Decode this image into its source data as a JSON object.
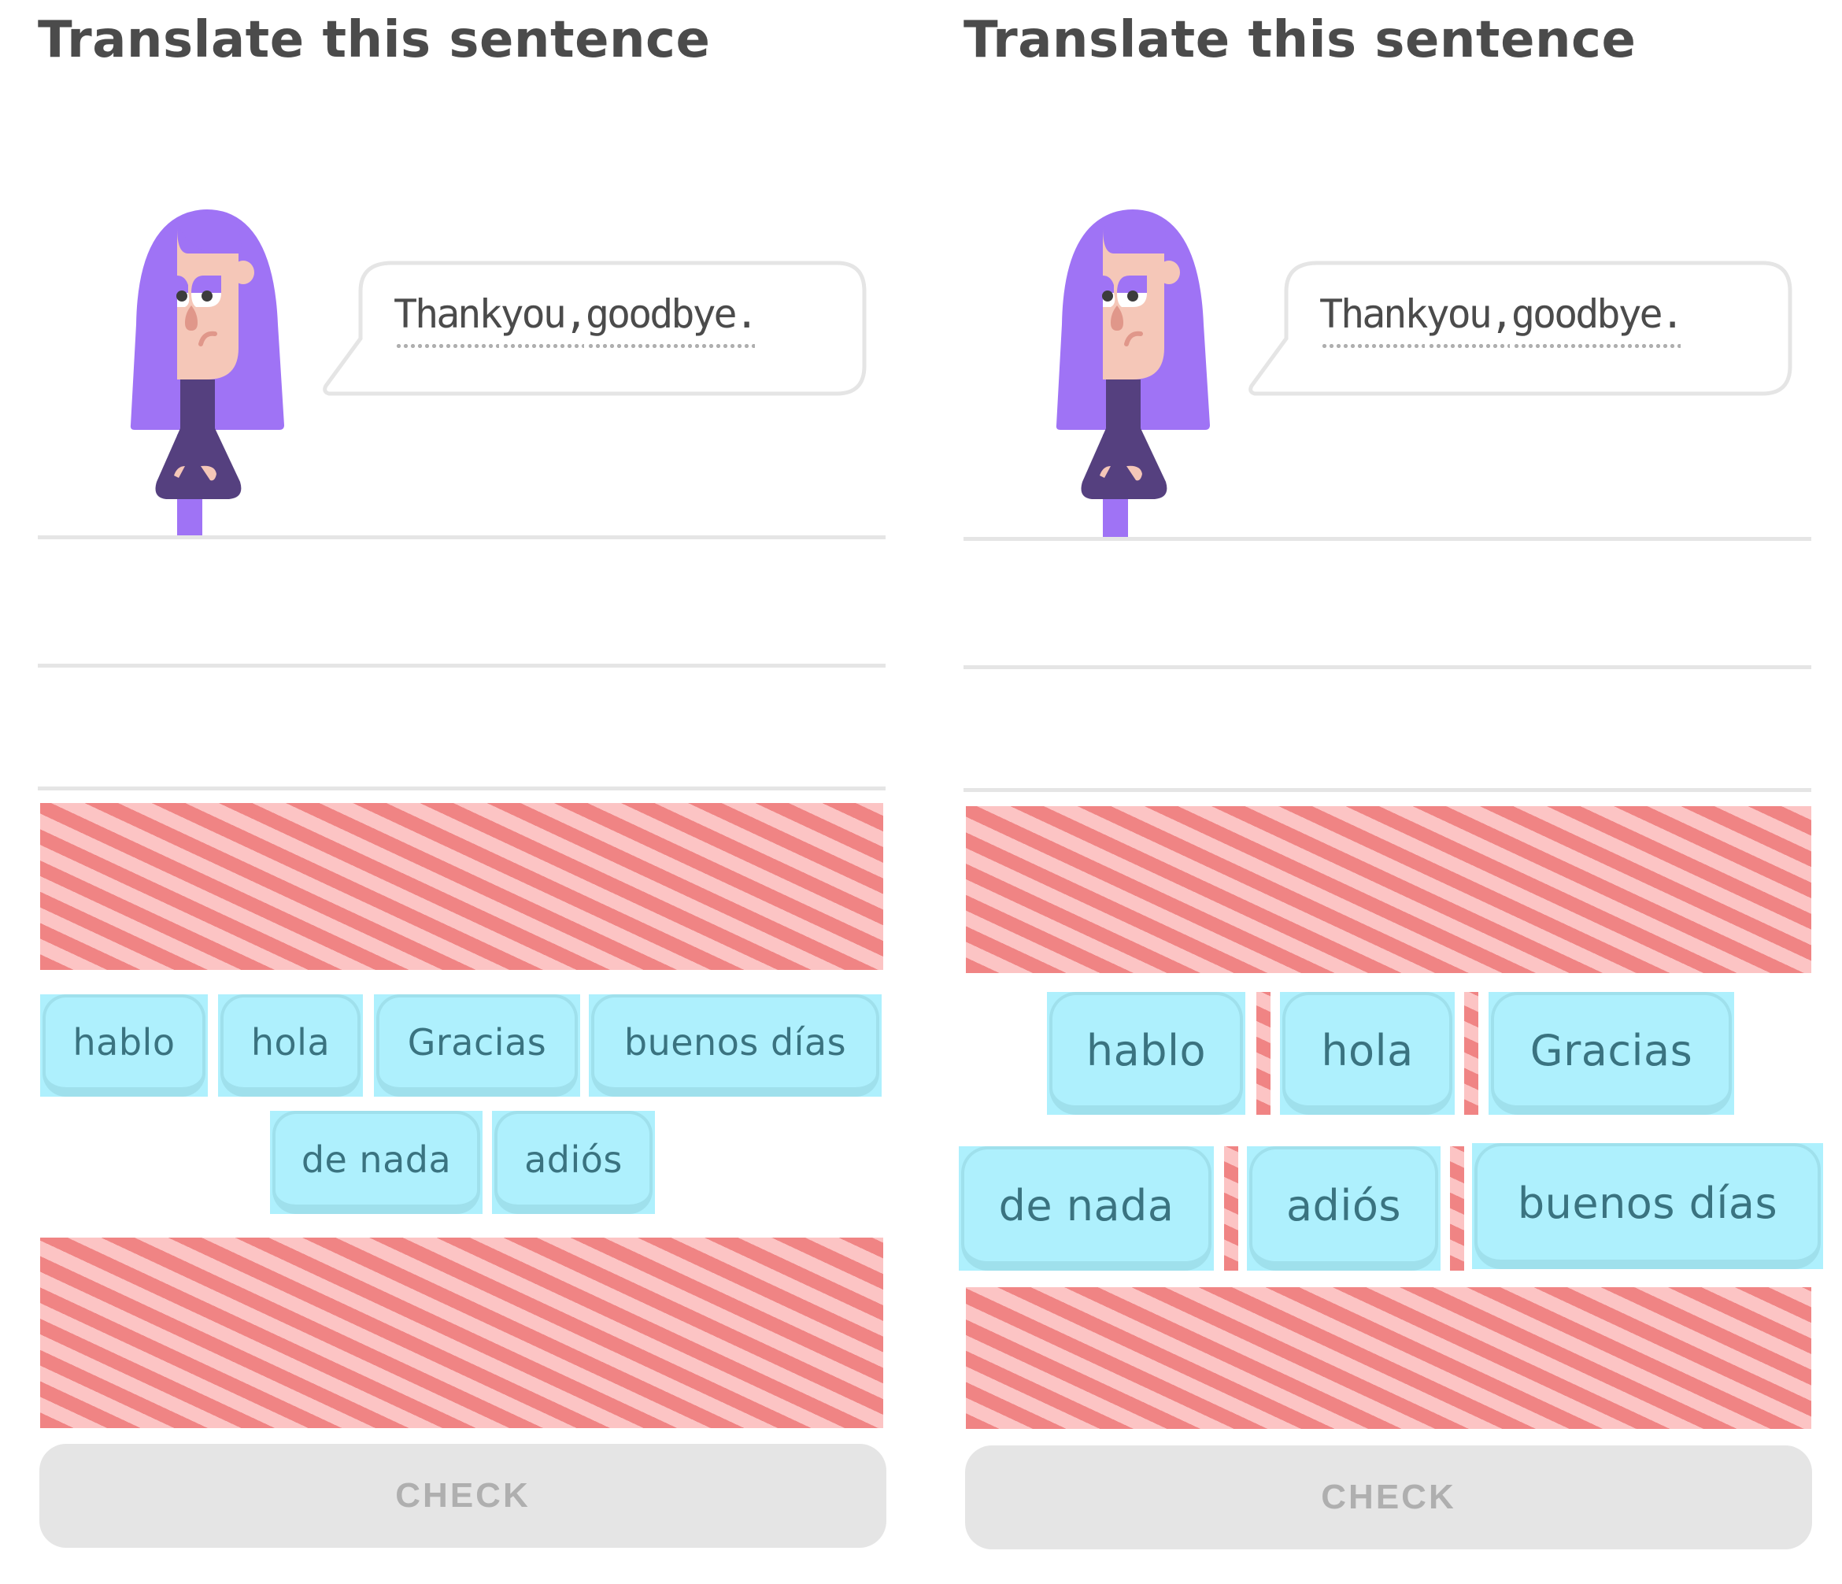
{
  "panels": [
    {
      "heading": "Translate this sentence",
      "prompt": {
        "words": [
          "Thank",
          "you,",
          "goodbye."
        ],
        "full_text": "Thank you, goodbye."
      },
      "word_bank": [
        [
          "hablo",
          "hola",
          "Gracias",
          "buenos días"
        ],
        [
          "de nada",
          "adiós"
        ]
      ],
      "check_label": "CHECK"
    },
    {
      "heading": "Translate this sentence",
      "prompt": {
        "words": [
          "Thank",
          "you,",
          "goodbye."
        ],
        "full_text": "Thank you, goodbye."
      },
      "word_bank": [
        [
          "hablo",
          "hola",
          "Gracias"
        ],
        [
          "de nada",
          "adiós",
          "buenos días"
        ]
      ],
      "check_label": "CHECK"
    }
  ],
  "colors": {
    "heading_text": "#4b4b4b",
    "hair": "#9f73f5",
    "sweater": "#55407f",
    "skin": "#f5c7b8",
    "tile_bg": "#aef0fd",
    "tile_border": "#9fe0ec",
    "tile_text": "#3a7380",
    "stripe_dark": "#f08484",
    "stripe_light": "#fcc4c4",
    "button_bg": "#e5e5e5",
    "button_text": "#afafaf"
  }
}
